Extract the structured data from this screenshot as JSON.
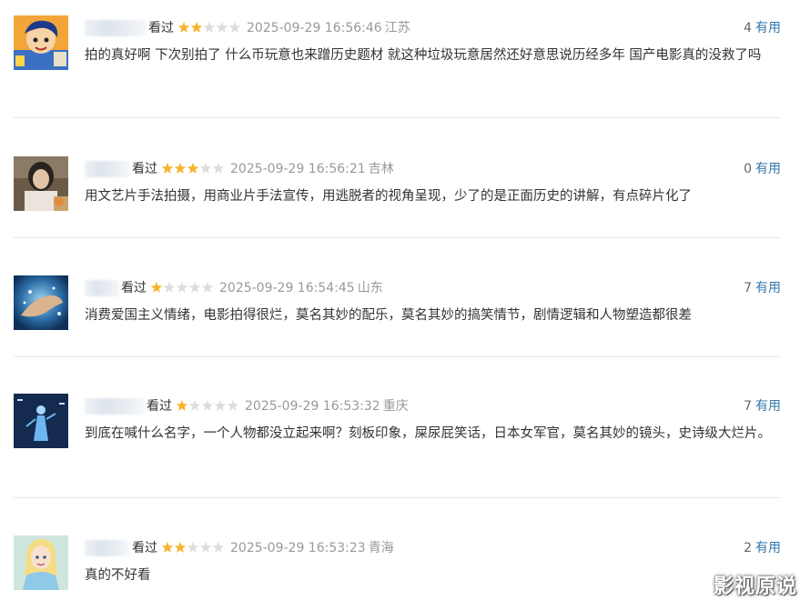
{
  "comments": [
    {
      "watched": "看过",
      "rating": 2,
      "time": "2025-09-29 16:56:46",
      "location": "江苏",
      "votes": "4",
      "useful_label": "有用",
      "text": "拍的真好啊 下次别拍了 什么币玩意也来蹭历史题材 就这种垃圾玩意居然还好意思说历经多年 国产电影真的没救了吗",
      "avatar_icon": "anime-character-avatar-icon"
    },
    {
      "watched": "看过",
      "rating": 3,
      "time": "2025-09-29 16:56:21",
      "location": "吉林",
      "votes": "0",
      "useful_label": "有用",
      "text": "用文艺片手法拍摄，用商业片手法宣传，用逃脱者的视角呈现，少了的是正面历史的讲解，有点碎片化了",
      "avatar_icon": "portrait-avatar-icon"
    },
    {
      "watched": "看过",
      "rating": 1,
      "time": "2025-09-29 16:54:45",
      "location": "山东",
      "votes": "7",
      "useful_label": "有用",
      "text": "消费爱国主义情绪，电影拍得很烂，莫名其妙的配乐，莫名其妙的搞笑情节，剧情逻辑和人物塑造都很差",
      "avatar_icon": "hand-splash-avatar-icon"
    },
    {
      "watched": "看过",
      "rating": 1,
      "time": "2025-09-29 16:53:32",
      "location": "重庆",
      "votes": "7",
      "useful_label": "有用",
      "text": "到底在喊什么名字，一个人物都没立起来啊？刻板印象，屎尿屁笑话，日本女军官，莫名其妙的镜头，史诗级大烂片。",
      "avatar_icon": "stage-figure-avatar-icon"
    },
    {
      "watched": "看过",
      "rating": 2,
      "time": "2025-09-29 16:53:23",
      "location": "青海",
      "votes": "2",
      "useful_label": "有用",
      "text": "真的不好看",
      "avatar_icon": "cartoon-princess-avatar-icon"
    }
  ],
  "watermark": "影视原说",
  "colors": {
    "star_filled": "#f7b32b",
    "star_empty": "#dddddd",
    "useful_link": "#3377aa",
    "meta_text": "#999999"
  }
}
